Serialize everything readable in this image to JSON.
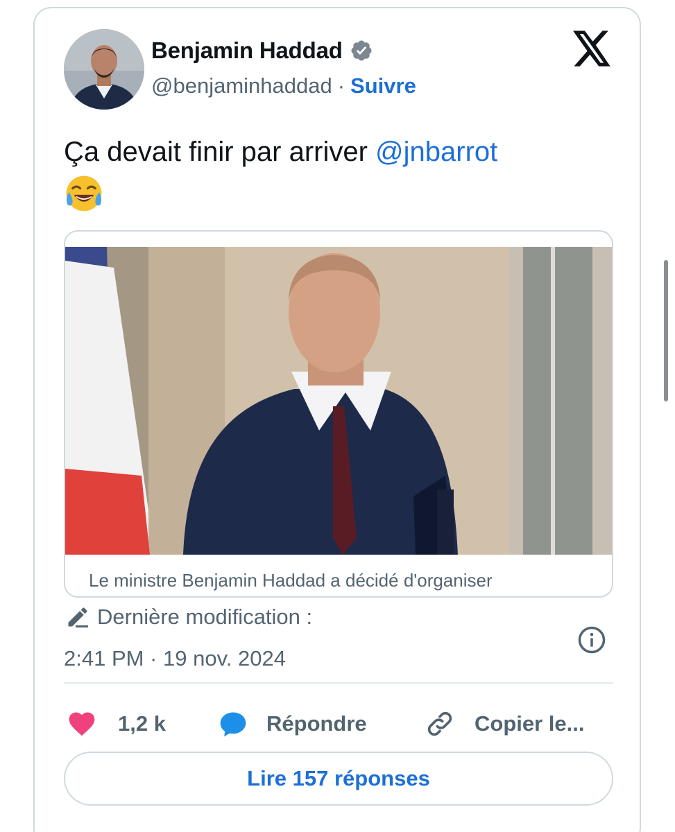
{
  "author": {
    "display_name": "Benjamin Haddad",
    "handle": "@benjaminhaddad",
    "separator": "·",
    "follow_label": "Suivre",
    "verified_icon": "verified-badge-icon",
    "avatar_icon": "avatar"
  },
  "brand": {
    "logo": "x-logo-icon"
  },
  "tweet": {
    "text": "Ça devait finir par arriver ",
    "mention": "@jnbarrot",
    "emoji": "face-with-tears-of-joy-icon"
  },
  "media": {
    "caption": "Le ministre Benjamin Haddad a décidé d'organiser"
  },
  "meta": {
    "edited_label": "Dernière modification :",
    "timestamp": "2:41 PM · 19 nov. 2024",
    "info_icon": "info-icon"
  },
  "actions": {
    "like_count": "1,2 k",
    "reply_label": "Répondre",
    "copy_label": "Copier le..."
  },
  "read_replies_label": "Lire 157 réponses",
  "colors": {
    "link_blue": "#1d6fd6",
    "like_pink": "#f0417d",
    "reply_blue": "#1d8fe8",
    "muted_gray": "#536471",
    "border": "#cfd9de"
  }
}
